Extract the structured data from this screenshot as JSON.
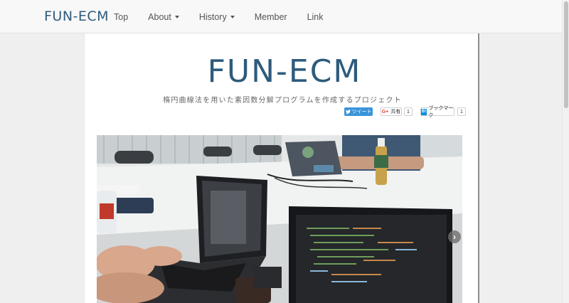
{
  "navbar": {
    "brand": "FUN-ECM",
    "items": [
      {
        "label": "Top",
        "dropdown": false
      },
      {
        "label": "About",
        "dropdown": true
      },
      {
        "label": "History",
        "dropdown": true
      },
      {
        "label": "Member",
        "dropdown": false
      },
      {
        "label": "Link",
        "dropdown": false
      }
    ]
  },
  "hero": {
    "logo": "FUN-ECM",
    "subtitle": "楕円曲線法を用いた素因数分解プログラムを作成するプロジェクト"
  },
  "share": {
    "tweet_label": "ツイート",
    "gplus_label": "共有",
    "gplus_count": "1",
    "hatena_label": "ブックマーク",
    "hatena_count": "1"
  },
  "carousel": {
    "next_label": "›"
  },
  "colors": {
    "brand": "#2e5b7c",
    "twitter": "#3b94d9",
    "hatena": "#008fde"
  }
}
